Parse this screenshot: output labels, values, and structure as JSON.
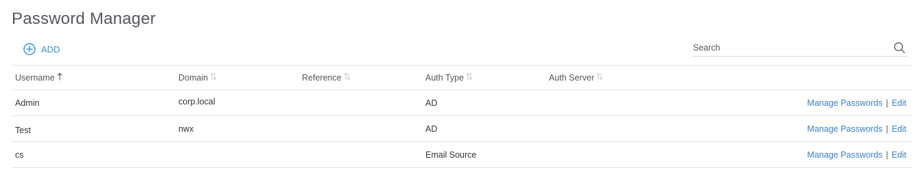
{
  "page": {
    "title": "Password Manager"
  },
  "toolbar": {
    "add_label": "ADD"
  },
  "search": {
    "placeholder": "Search",
    "value": ""
  },
  "table": {
    "columns": [
      {
        "label": "Username",
        "sort": "ascending"
      },
      {
        "label": "Domain",
        "sort": "none"
      },
      {
        "label": "Reference",
        "sort": "none"
      },
      {
        "label": "Auth Type",
        "sort": "none"
      },
      {
        "label": "Auth Server",
        "sort": "none"
      }
    ],
    "rows": [
      {
        "username": "Admin",
        "domain": "corp.local",
        "reference": "",
        "auth_type": "AD",
        "auth_server": "",
        "manage_label": "Manage Passwords",
        "separator": "|",
        "edit_label": "Edit"
      },
      {
        "username": "Test",
        "domain": "nwx",
        "reference": "",
        "auth_type": "AD",
        "auth_server": "",
        "manage_label": "Manage Passwords",
        "separator": "|",
        "edit_label": "Edit"
      },
      {
        "username": "cs",
        "domain": "",
        "reference": "",
        "auth_type": "Email Source",
        "auth_server": "",
        "manage_label": "Manage Passwords",
        "separator": "|",
        "edit_label": "Edit"
      }
    ]
  },
  "colors": {
    "accent": "#3a8fd1",
    "link": "#3a7fc2",
    "border": "#e2e2e2",
    "title": "#555560"
  },
  "icons": {
    "add": "plus-circle-icon",
    "search": "search-icon",
    "sort_asc": "arrow-up-icon",
    "sort_none": "sort-arrows-icon"
  }
}
